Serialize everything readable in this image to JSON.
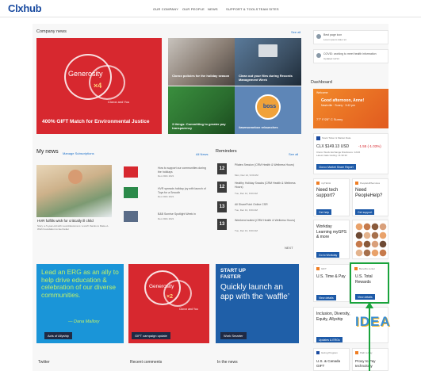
{
  "header": {
    "logo": "Clxhub",
    "nav": [
      "OUR COMPANY",
      "OUR PEOPLE",
      "NEWS",
      "SUPPORT & TOOLS",
      "TEAM SITES"
    ]
  },
  "company_news": {
    "title": "Company news",
    "see_all": "See all",
    "hero": {
      "headline": "400% GIFT Match for Environmental Justice",
      "graphic_word": "Generosity",
      "graphic_mult": "×4",
      "graphic_brand": "Clorox and You"
    },
    "tiles": [
      {
        "caption": "Clorox policies for the holiday season"
      },
      {
        "caption": "Clean out your files during Records Management Week"
      },
      {
        "caption": "3 things: Committing to greater pay transparency"
      },
      {
        "caption": "#awesomebox relaunches",
        "badge": "boss"
      }
    ]
  },
  "sidebar_top": {
    "items": [
      {
        "title": "Best page icon",
        "sub": "Lorem ipsum dolor sit"
      },
      {
        "title": "COVID: working to meet health information",
        "sub": "Updated 12/14"
      }
    ]
  },
  "dashboard": {
    "title": "Dashboard",
    "welcome": {
      "label": "Welcome",
      "greeting": "Good afternoon, Anne!",
      "sub": "Nashville · Sunny · 3:42 pm",
      "weather": "77° F/25° C  Sunny"
    },
    "stock": {
      "label": "Stock Ticker & Market Data",
      "price": "CLX $149.13 USD",
      "change": "-1.55 (-1.03%)",
      "meta1": "Clorox Stock Exchange Disclosure: 12/22",
      "meta2": "Latest trade trading: 11:30:32",
      "button": "Clorox Market Share Report"
    },
    "cards": [
      {
        "label": "myTECH",
        "title": "Need tech support?",
        "button": "Get help"
      },
      {
        "label": "PeopleHRServices",
        "title": "Need PeopleHelp?",
        "button": "Get support"
      },
      {
        "label": "Workday",
        "title": "Workday Learning myGPS & more",
        "button": "Go to Workday"
      },
      {
        "label": "GIFT",
        "title": "U.S. Time & Pay",
        "button": "View details"
      },
      {
        "label": "Benefits center",
        "title": "U.S. Total Rewards",
        "button": "View details"
      },
      {
        "label": "IDEA",
        "title": "Inclusion, Diversity, Equity, Allyship",
        "button": "Updates & ERGs",
        "art": "IDEA"
      },
      {
        "label": "Giving Program",
        "title": "U.S. & Canada GIFT",
        "button": ""
      },
      {
        "label": "Path to Pay",
        "title": "Proxy to Pay technology",
        "button": ""
      }
    ]
  },
  "my_news": {
    "title": "My news",
    "manage": "Manage Subscriptions",
    "all_news": "All News",
    "feature": {
      "caption": "HVR fulfills wish for critically ill child",
      "sub": "Story: a 5-year-old with neuroblastoma is ‘a wish’ thanks to Make-A-Wish Foundation to feel better"
    },
    "items": [
      {
        "title": "How to support our communities during the holidays",
        "date": "Dec 2021 2021"
      },
      {
        "title": "HVR spreads holiday joy with launch of Toys for a Smooth",
        "date": "Dec 2021 2021"
      },
      {
        "title": "B&B Sonrise Spotlight Week in",
        "date": "Dec 2021 2021"
      }
    ]
  },
  "reminders": {
    "title": "Reminders",
    "see_all": "See all",
    "items": [
      {
        "day": "12",
        "title": "Pilates Session (CRM Health & Wellness Hours)",
        "time": "Mon, Dec 12, 9:00 AM"
      },
      {
        "day": "12",
        "title": "Healthy Holiday Snacks (CRM Health & Wellness Hours)",
        "time": "Tue, Dec 12, 9:00 AM"
      },
      {
        "day": "13",
        "title": "All SharePoint Online CSR",
        "time": "Tue, Dec 13, 9:00 AM"
      },
      {
        "day": "13",
        "title": "Weekend suited (CRM Health & Wellness Hours)",
        "time": "Tue, Dec 13, 9:00 AM"
      }
    ],
    "next": "NEXT"
  },
  "promos": [
    {
      "text": "Lead an ERG as an ally to help drive education & celebration of our diverse communities.",
      "attribution": "— Dana Mallory",
      "button": "Acts of Allyship"
    },
    {
      "graphic_word": "Generosity",
      "graphic_mult": "×2",
      "graphic_brand": "Clorox and You",
      "button": "GIFT campaign update"
    },
    {
      "kicker": "START UP FASTER",
      "text": "Quickly launch an app with the ‘waffle’",
      "button": "Work Smarter"
    }
  ],
  "footer_sections": [
    "Twitter",
    "Recent comments",
    "In the news"
  ],
  "colors": {
    "brand_blue": "#1a4ba0",
    "red": "#d7282f",
    "orange": "#ef7d22",
    "highlight_green": "#1aa33c"
  }
}
